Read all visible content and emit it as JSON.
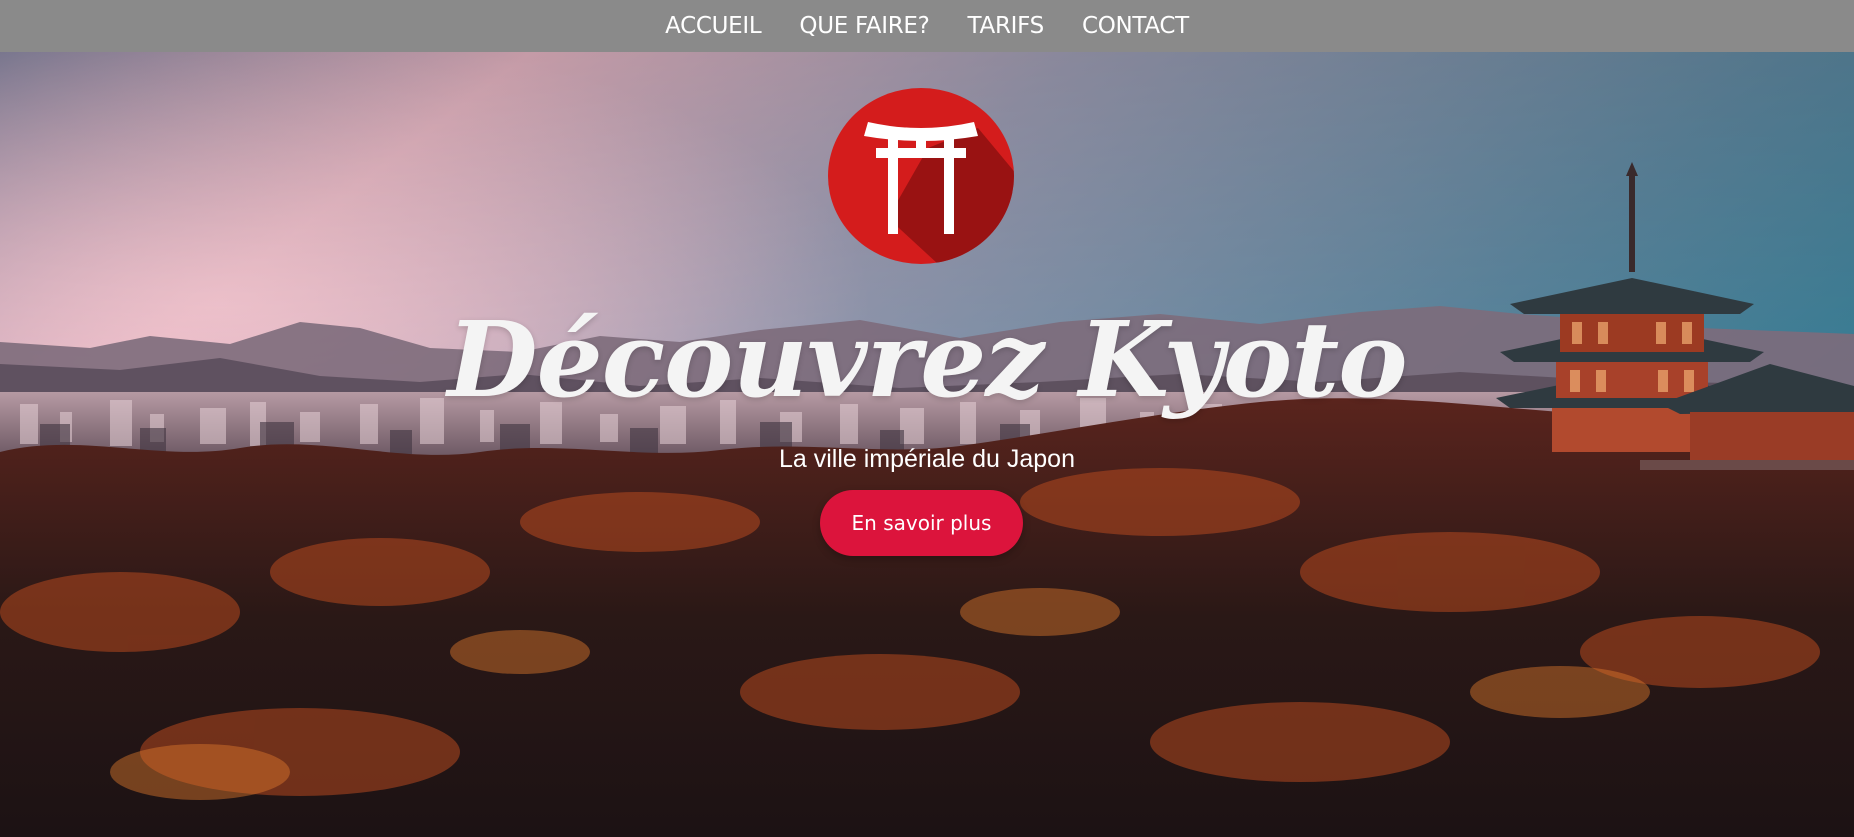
{
  "nav": {
    "items": [
      {
        "label": "ACCUEIL"
      },
      {
        "label": "QUE FAIRE?"
      },
      {
        "label": "TARIFS"
      },
      {
        "label": "CONTACT"
      }
    ]
  },
  "hero": {
    "logo_icon": "torii-gate-icon",
    "title": "Découvrez Kyoto",
    "subtitle": "La ville impériale du Japon",
    "cta_label": "En savoir plus",
    "background_scene": "kyoto-sunset-pagoda-image"
  },
  "colors": {
    "nav_background": "#8a8a8a",
    "accent": "#dc143c",
    "logo_red": "#d41c1c",
    "text": "#ffffff"
  }
}
